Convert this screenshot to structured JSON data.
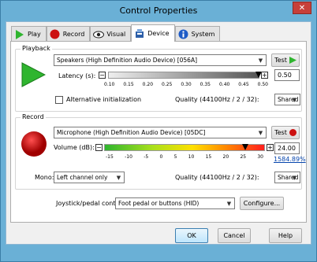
{
  "window": {
    "title": "Control Properties",
    "close_glyph": "✕"
  },
  "tabs": [
    {
      "label": "Play",
      "icon": "play-icon"
    },
    {
      "label": "Record",
      "icon": "record-icon"
    },
    {
      "label": "Visual",
      "icon": "eye-icon"
    },
    {
      "label": "Device",
      "icon": "device-icon",
      "active": true
    },
    {
      "label": "System",
      "icon": "info-icon"
    }
  ],
  "playback": {
    "group_label": "Playback",
    "device": "Speakers (High Definition Audio Device) [056A]",
    "test_label": "Test",
    "latency_label": "Latency (s):",
    "latency_value": "0.50",
    "latency_fraction": 1.0,
    "latency_ticks": [
      "0.10",
      "0.15",
      "0.20",
      "0.25",
      "0.30",
      "0.35",
      "0.40",
      "0.45",
      "0.50"
    ],
    "alt_init_label": "Alternative initialization",
    "alt_init_checked": false,
    "quality_label": "Quality (44100Hz / 2 / 32):",
    "quality_value": "Shared"
  },
  "record": {
    "group_label": "Record",
    "device": "Microphone (High Definition Audio Device) [05DC]",
    "test_label": "Test",
    "volume_label": "Volume (dB):",
    "volume_value": "24.00",
    "volume_percent": "1584.89%",
    "volume_fraction": 0.88,
    "volume_ticks": [
      "-15",
      "-10",
      "-5",
      "0",
      "5",
      "10",
      "15",
      "20",
      "25",
      "30"
    ],
    "mono_label": "Mono:",
    "mono_value": "Left channel only",
    "quality_label": "Quality (44100Hz / 2 / 32):",
    "quality_value": "Shared"
  },
  "joystick": {
    "label": "Joystick/pedal control:",
    "value": "Foot pedal or buttons (HID)",
    "configure_label": "Configure..."
  },
  "buttons": {
    "ok": "OK",
    "cancel": "Cancel",
    "help": "Help"
  },
  "colors": {
    "play_green": "#2fb52f",
    "record_red": "#cc1111",
    "accent": "#6ab0d6"
  }
}
